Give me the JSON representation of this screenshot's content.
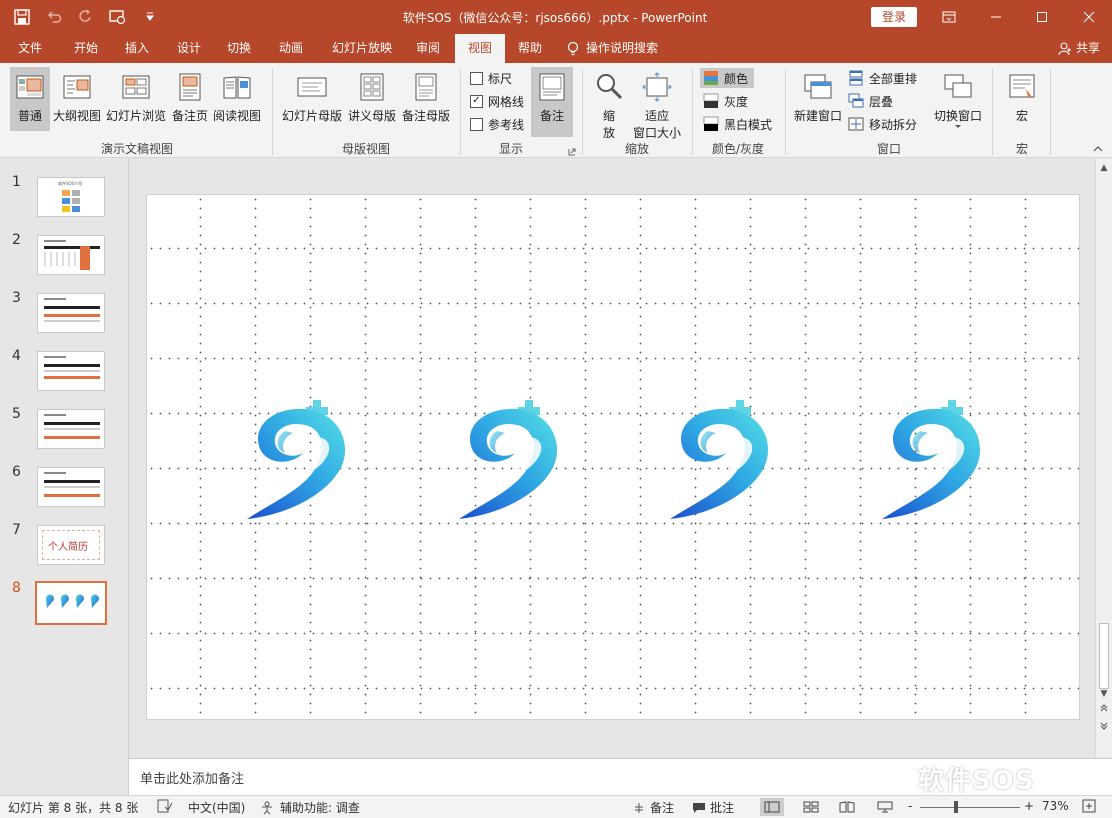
{
  "window": {
    "title": "软件SOS（微信公众号：rjsos666）.pptx  -  PowerPoint",
    "login": "登录"
  },
  "tabs": [
    "文件",
    "开始",
    "插入",
    "设计",
    "切换",
    "动画",
    "幻灯片放映",
    "审阅",
    "视图",
    "帮助"
  ],
  "active_tab": "视图",
  "tell_me": "操作说明搜索",
  "share": "共享",
  "ribbon": {
    "presentation_views": {
      "label": "演示文稿视图",
      "normal": "普通",
      "outline": "大纲视图",
      "sorter": "幻灯片浏览",
      "notes_page": "备注页",
      "reading": "阅读视图"
    },
    "master_views": {
      "label": "母版视图",
      "slide_master": "幻灯片母版",
      "handout_master": "讲义母版",
      "notes_master": "备注母版"
    },
    "show": {
      "label": "显示",
      "ruler": "标尺",
      "gridlines": "网格线",
      "guides": "参考线",
      "notes": "备注",
      "ruler_checked": false,
      "gridlines_checked": true,
      "guides_checked": false
    },
    "zoom": {
      "label": "缩放",
      "zoom_line1": "缩",
      "zoom_line2": "放",
      "fit_line1": "适应",
      "fit_line2": "窗口大小"
    },
    "color": {
      "label": "颜色/灰度",
      "color": "颜色",
      "grayscale": "灰度",
      "bw": "黑白模式"
    },
    "window": {
      "label": "窗口",
      "new_window": "新建窗口",
      "arrange_all": "全部重排",
      "cascade": "层叠",
      "move_split": "移动拆分",
      "switch_windows": "切换窗口"
    },
    "macros": {
      "label": "宏",
      "macros": "宏"
    }
  },
  "thumbnails": [
    {
      "number": "1",
      "caption": "软件SOS介绍"
    },
    {
      "number": "2"
    },
    {
      "number": "3"
    },
    {
      "number": "4"
    },
    {
      "number": "5"
    },
    {
      "number": "6"
    },
    {
      "number": "7",
      "caption": "个人简历"
    },
    {
      "number": "8"
    }
  ],
  "active_slide": 8,
  "slide": {
    "logo_count": 4
  },
  "notes_placeholder": "单击此处添加备注",
  "statusbar": {
    "slide_info": "幻灯片 第 8 张，共 8 张",
    "language": "中文(中国)",
    "accessibility": "辅助功能: 调查",
    "notes": "备注",
    "comments": "批注",
    "zoom": "73%",
    "minus": "-",
    "plus": "+"
  },
  "watermark": "软件SOS",
  "colors": {
    "accent": "#b7472a",
    "ribbon_bg": "#f3f3f3",
    "logo_light": "#4fd6e0",
    "logo_dark": "#1f5fd6",
    "active_thumb_border": "#e0703e"
  }
}
